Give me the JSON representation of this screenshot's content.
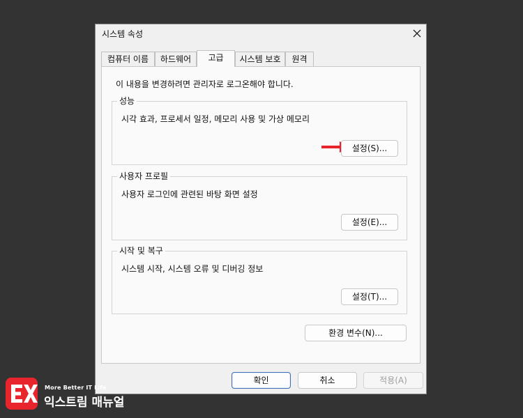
{
  "window": {
    "title": "시스템 속성",
    "close_icon": "close-icon"
  },
  "tabs": [
    {
      "label": "컴퓨터 이름",
      "active": false
    },
    {
      "label": "하드웨어",
      "active": false
    },
    {
      "label": "고급",
      "active": true
    },
    {
      "label": "시스템 보호",
      "active": false
    },
    {
      "label": "원격",
      "active": false
    }
  ],
  "panel": {
    "note": "이 내용을 변경하려면 관리자로 로그온해야 합니다.",
    "groups": [
      {
        "title": "성능",
        "description": "시각 효과, 프로세서 일정, 메모리 사용 및 가상 메모리",
        "button": "설정(S)..."
      },
      {
        "title": "사용자 프로필",
        "description": "사용자 로그인에 관련된 바탕 화면 설정",
        "button": "설정(E)..."
      },
      {
        "title": "시작 및 복구",
        "description": "시스템 시작, 시스템 오류 및 디버깅 정보",
        "button": "설정(T)..."
      }
    ],
    "env_button": "환경 변수(N)..."
  },
  "footer": {
    "ok": "확인",
    "cancel": "취소",
    "apply": "적용(A)"
  },
  "annotation": {
    "arrow_color": "#e8232b",
    "arrow_icon": "red-arrow-icon"
  },
  "watermark": {
    "tagline": "More Better IT Life",
    "name": "익스트림 매뉴얼",
    "badge_color": "#e8252c"
  }
}
